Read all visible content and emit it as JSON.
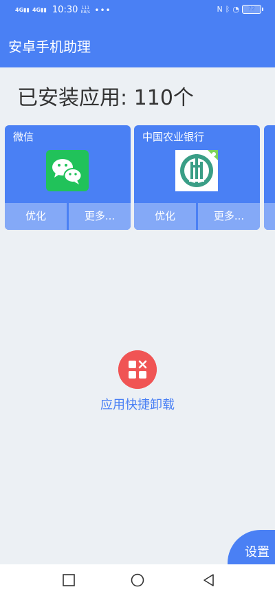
{
  "status_bar": {
    "signal1": "4G",
    "signal2": "4G",
    "time": "10:30",
    "speed_line1": "111",
    "speed_line2": "KB/s",
    "dots": "•••",
    "battery": "72"
  },
  "header": {
    "title": "安卓手机助理"
  },
  "installed": {
    "label": "已安装应用: 110个"
  },
  "apps": [
    {
      "name": "微信",
      "optimize_label": "优化",
      "more_label": "更多..."
    },
    {
      "name": "中国农业银行",
      "optimize_label": "优化",
      "more_label": "更多..."
    }
  ],
  "uninstall": {
    "label": "应用快捷卸载"
  },
  "settings": {
    "label": "设置"
  },
  "colors": {
    "primary": "#4a80f4",
    "button": "#84a9f7",
    "background": "#ecf0f4",
    "danger": "#f05454",
    "wechat": "#21c25a",
    "abc_green": "#3a9e86"
  }
}
